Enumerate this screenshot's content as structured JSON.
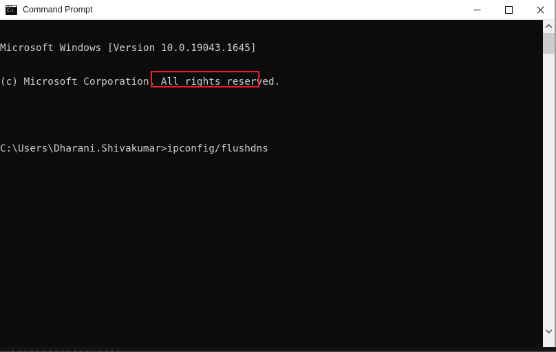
{
  "window": {
    "title": "Command Prompt",
    "icon": "command-prompt-icon",
    "icon_glyph": "C:\\",
    "background_color": "#0c0c0c",
    "text_color": "#cccccc"
  },
  "titlebar": {
    "minimize_label": "Minimize",
    "maximize_label": "Maximize",
    "close_label": "Close",
    "minimize_icon": "minimize-icon",
    "maximize_icon": "maximize-icon",
    "close_icon": "close-icon"
  },
  "console": {
    "lines": [
      "Microsoft Windows [Version 10.0.19043.1645]",
      "(c) Microsoft Corporation. All rights reserved.",
      "",
      "C:\\Users\\Dharani.Shivakumar>ipconfig/flushdns"
    ],
    "prompt_path": "C:\\Users\\Dharani.Shivakumar>",
    "command": "ipconfig/flushdns",
    "os_banner": "Microsoft Windows [Version 10.0.19043.1645]",
    "copyright": "(c) Microsoft Corporation. All rights reserved.",
    "os_version": "10.0.19043.1645"
  },
  "highlight": {
    "target": "ipconfig/flushdns",
    "color": "#ee1c25"
  },
  "scrollbar": {
    "up_arrow_icon": "chevron-up-icon",
    "down_arrow_icon": "chevron-down-icon",
    "thumb_label": "scroll-thumb"
  }
}
